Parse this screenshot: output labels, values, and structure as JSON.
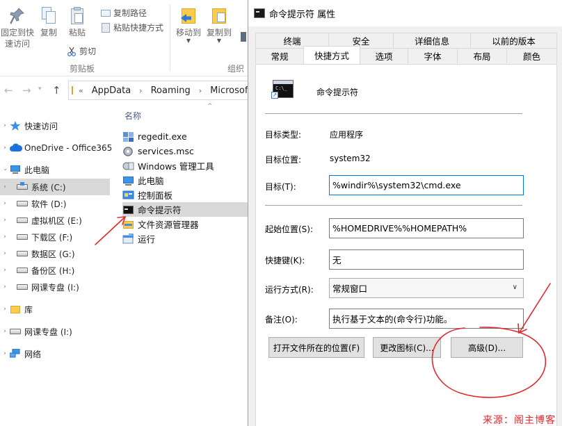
{
  "explorer": {
    "ribbon": {
      "pin_label_line1": "固定到快",
      "pin_label_line2": "速访问",
      "copy_label": "复制",
      "paste_label": "粘贴",
      "copy_path_label": "复制路径",
      "paste_shortcut_label": "粘贴快捷方式",
      "cut_label": "剪切",
      "clipboard_group": "剪贴板",
      "move_to_label": "移动到",
      "copy_to_label": "复制到",
      "organize_group": "组织"
    },
    "address": {
      "overflow": "«",
      "crumbs": [
        "AppData",
        "Roaming",
        "Microsoft"
      ]
    },
    "nav": {
      "items": [
        {
          "label": "快速访问",
          "icon": "star-icon"
        },
        {
          "label": "OneDrive - Office365",
          "icon": "cloud-icon"
        },
        {
          "label": "此电脑",
          "icon": "computer-icon"
        },
        {
          "label": "系统 (C:)",
          "icon": "drive-icon"
        },
        {
          "label": "软件 (D:)",
          "icon": "drive-icon"
        },
        {
          "label": "虚拟机区 (E:)",
          "icon": "drive-icon"
        },
        {
          "label": "下载区 (F:)",
          "icon": "drive-icon"
        },
        {
          "label": "数据区 (G:)",
          "icon": "drive-icon"
        },
        {
          "label": "备份区 (H:)",
          "icon": "drive-icon"
        },
        {
          "label": "网课专盘 (I:)",
          "icon": "drive-icon"
        },
        {
          "label": "库",
          "icon": "library-icon"
        },
        {
          "label": "网课专盘 (I:)",
          "icon": "drive-icon"
        },
        {
          "label": "网络",
          "icon": "network-icon"
        }
      ]
    },
    "files": {
      "column_header": "名称",
      "rows": [
        {
          "name": "regedit.exe",
          "icon": "registry-icon"
        },
        {
          "name": "services.msc",
          "icon": "services-icon"
        },
        {
          "name": "Windows 管理工具",
          "icon": "admin-tools-icon"
        },
        {
          "name": "此电脑",
          "icon": "computer-icon"
        },
        {
          "name": "控制面板",
          "icon": "control-panel-icon"
        },
        {
          "name": "命令提示符",
          "icon": "cmd-icon"
        },
        {
          "name": "文件资源管理器",
          "icon": "folder-icon"
        },
        {
          "name": "运行",
          "icon": "run-icon"
        }
      ]
    }
  },
  "dialog": {
    "title": "命令提示符 属性",
    "tabs_row1": [
      "终端",
      "安全",
      "详细信息",
      "以前的版本"
    ],
    "tabs_row2": [
      "常规",
      "快捷方式",
      "选项",
      "字体",
      "布局",
      "颜色"
    ],
    "active_tab": "快捷方式",
    "shortcut_name": "命令提示符",
    "target_type_label": "目标类型:",
    "target_type_value": "应用程序",
    "target_location_label": "目标位置:",
    "target_location_value": "system32",
    "target_label": "目标(T):",
    "target_value": "%windir%\\system32\\cmd.exe",
    "start_in_label": "起始位置(S):",
    "start_in_value": "%HOMEDRIVE%%HOMEPATH%",
    "hotkey_label": "快捷键(K):",
    "hotkey_value": "无",
    "run_label": "运行方式(R):",
    "run_value": "常规窗口",
    "comment_label": "备注(O):",
    "comment_value": "执行基于文本的(命令行)功能。",
    "open_location_button": "打开文件所在的位置(F)",
    "change_icon_button": "更改图标(C)...",
    "advanced_button": "高级(D)..."
  },
  "annotation": {
    "color": "#e0282e",
    "watermark": "来源：阁主博客"
  }
}
